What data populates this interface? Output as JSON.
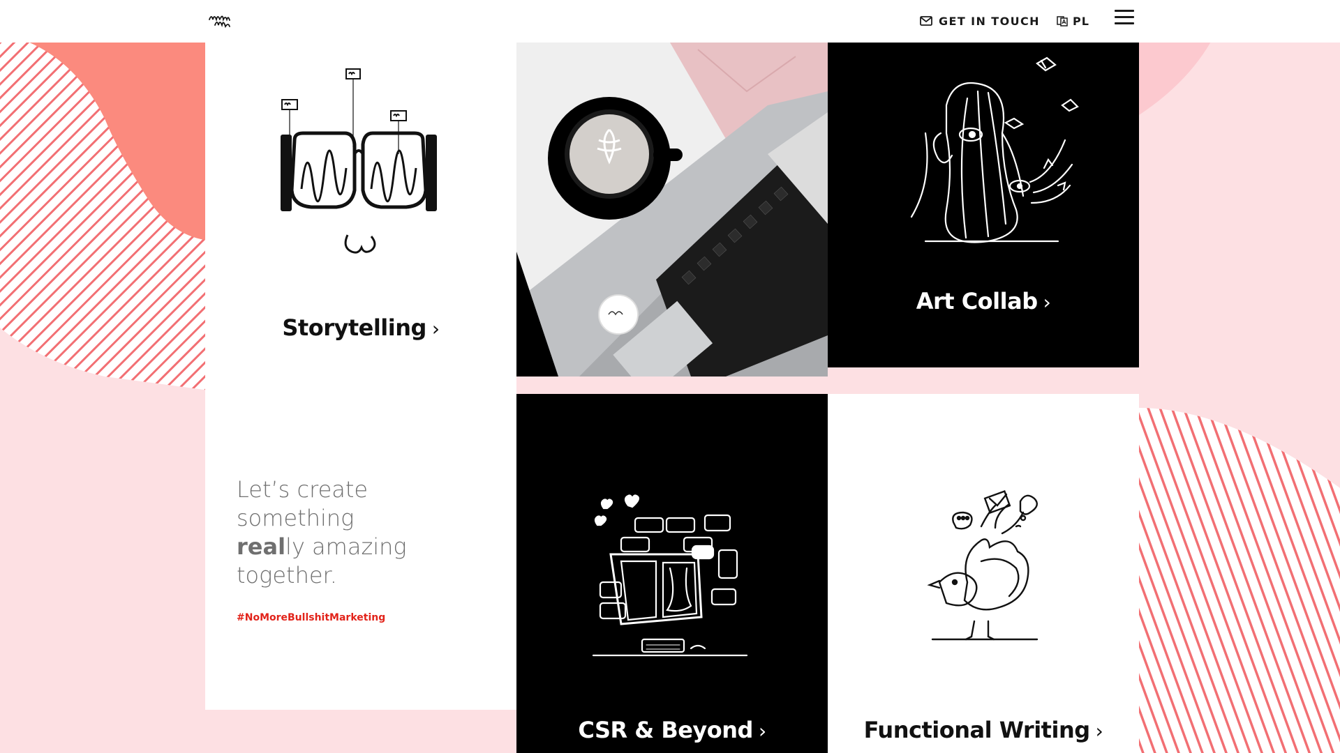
{
  "header": {
    "logo_name": "brand-logo",
    "contact_label": "GET IN TOUCH",
    "contact_icon": "envelope-icon",
    "language_label": "PL",
    "language_icon": "language-icon",
    "menu_icon": "hamburger-menu-icon"
  },
  "tiles": {
    "storytelling": {
      "label": "Storytelling",
      "chevron": "›"
    },
    "photo": {
      "alt": ""
    },
    "art_collab": {
      "label": "Art Collab",
      "chevron": "›"
    },
    "csr": {
      "label": "CSR & Beyond",
      "chevron": "›"
    },
    "functional": {
      "label": "Functional Writing",
      "chevron": "›"
    }
  },
  "tagline": {
    "line1": "Let’s create",
    "line2": "something",
    "line3_bold": "real",
    "line3_rest": "ly amazing",
    "line4": "together."
  },
  "hashtag": "#NoMoreBullshitMarketing",
  "colors": {
    "accent_red": "#e2231a",
    "coral": "#fb8a7e",
    "pink_bg": "#fde0e3",
    "stripe": "#f26f73",
    "black_tile": "#000000"
  }
}
